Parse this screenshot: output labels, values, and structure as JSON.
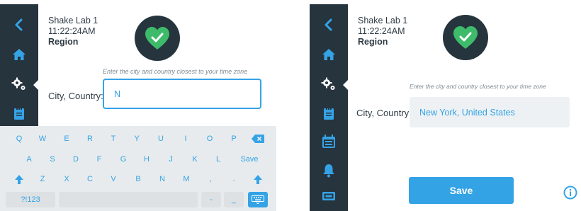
{
  "colors": {
    "accent": "#34a3e6",
    "sidebar": "#26343e",
    "badge_check": "#3dbb6a",
    "keyboard_bg": "#e8ebed"
  },
  "screens": [
    {
      "header": {
        "line1": "Shake Lab 1",
        "time": "11:22:24AM",
        "section": "Region"
      },
      "sidebar": {
        "items": [
          "back-icon",
          "home-icon",
          "settings-gears-icon",
          "notepad-icon"
        ],
        "active": "settings-gears-icon"
      },
      "status_icon": "heart-check-icon",
      "hint": "Enter the city and country closest to your time zone",
      "field_label": "City, Country:",
      "input_value": "N",
      "keyboard": {
        "row1": [
          "Q",
          "W",
          "E",
          "R",
          "T",
          "Y",
          "U",
          "I",
          "O",
          "P"
        ],
        "row2": [
          "A",
          "S",
          "D",
          "F",
          "G",
          "H",
          "J",
          "K",
          "L"
        ],
        "row2_action": "Save",
        "row3": [
          "Z",
          "X",
          "C",
          "V",
          "B",
          "N",
          "M",
          ",",
          "."
        ],
        "row4_mode": "?!123",
        "row4_keys": [
          "-",
          "_"
        ],
        "icons": [
          "backspace-icon",
          "shift-icon",
          "keyboard-hide-icon"
        ]
      }
    },
    {
      "header": {
        "line1": "Shake Lab 1",
        "time": "11:22:24AM",
        "section": "Region"
      },
      "sidebar": {
        "items": [
          "back-icon",
          "home-icon",
          "settings-gears-icon",
          "notepad-icon",
          "calendar-icon",
          "bell-icon",
          "display-icon"
        ],
        "active": "settings-gears-icon"
      },
      "status_icon": "heart-check-icon",
      "hint": "Enter the city and country closest to your time zone",
      "field_label": "City, Country:",
      "input_value": "New York, United States",
      "save_label": "Save",
      "info_icon": "info-icon"
    }
  ]
}
